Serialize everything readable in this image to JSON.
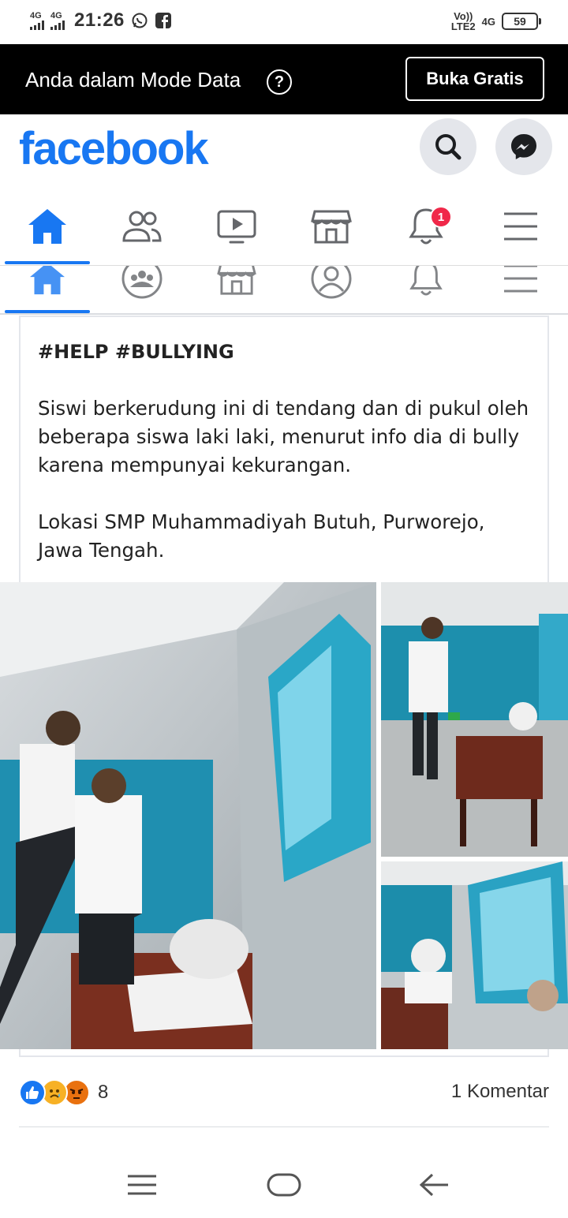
{
  "status_bar": {
    "network_left_1": "4G",
    "network_left_2": "4G",
    "time": "21:26",
    "volte": "Vo))",
    "lte": "LTE2",
    "network_right": "4G",
    "battery": "59",
    "icons": [
      "whatsapp-icon",
      "facebook-square-icon"
    ]
  },
  "data_banner": {
    "text": "Anda dalam Mode Data",
    "help": "?",
    "button": "Buka Gratis"
  },
  "header": {
    "logo": "facebook",
    "search_icon": "search-icon",
    "messenger_icon": "messenger-icon"
  },
  "tabs": {
    "items": [
      "home",
      "friends",
      "watch",
      "marketplace",
      "notifications",
      "menu"
    ],
    "active": "home",
    "notification_badge": "1"
  },
  "post": {
    "tags": "#HELP #BULLYING",
    "paragraph_1": "Siswi berkerudung ini di tendang dan di pukul oleh beberapa siswa laki laki, menurut info dia di bully karena mempunyai kekurangan.",
    "paragraph_2": "Lokasi SMP Muhammadiyah Butuh, Purworejo, Jawa Tengah.",
    "reaction_types": [
      "like",
      "sad",
      "angry"
    ],
    "reaction_count": "8",
    "comments": "1 Komentar"
  },
  "colors": {
    "brand": "#1877f2",
    "badge": "#f02849",
    "banner_bg": "#000000"
  },
  "navbar": {
    "icons": [
      "recent-apps-icon",
      "home-nav-icon",
      "back-icon"
    ]
  }
}
